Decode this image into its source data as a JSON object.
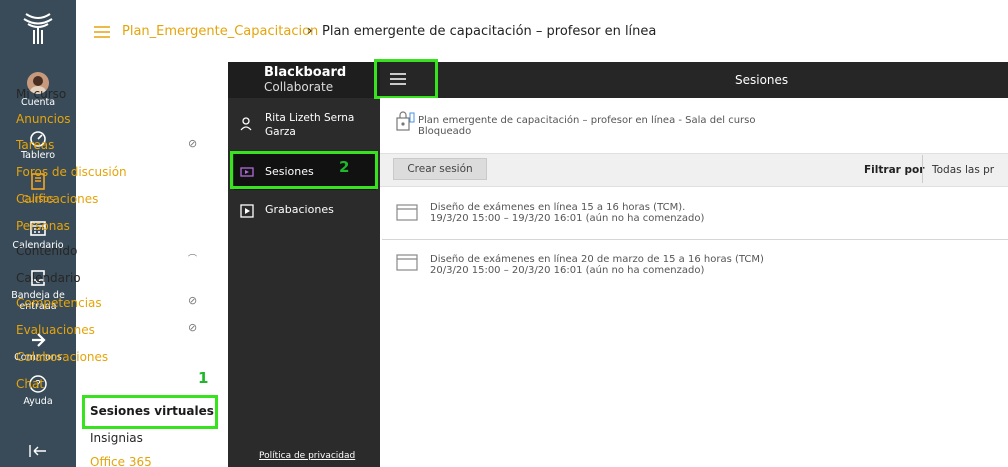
{
  "global_nav": {
    "items": [
      {
        "label": "Cuenta",
        "icon": "avatar"
      },
      {
        "label": "Tablero",
        "icon": "dashboard-icon"
      },
      {
        "label": "Cursos",
        "icon": "courses-icon"
      },
      {
        "label": "Calendario",
        "icon": "calendar-icon"
      },
      {
        "label": "Bandeja de entrada",
        "icon": "inbox-icon"
      },
      {
        "label": "Commons",
        "icon": "commons-icon"
      },
      {
        "label": "Ayuda",
        "icon": "help-icon"
      }
    ],
    "active_item": "Cursos",
    "colors": {
      "background": "#394b58",
      "active": "#f5a623"
    }
  },
  "breadcrumb": {
    "course": "Plan_Emergente_Capacitacion",
    "separator": "›",
    "current": "Plan emergente de capacitación – profesor en línea"
  },
  "course_menu": {
    "items": [
      {
        "label": "Mi curso",
        "style": "dark"
      },
      {
        "label": "Anuncios",
        "style": "link"
      },
      {
        "label": "Tareas",
        "style": "link",
        "hidden": true
      },
      {
        "label": "Foros de discusión",
        "style": "link"
      },
      {
        "label": "Calificaciones",
        "style": "link"
      },
      {
        "label": "Personas",
        "style": "link"
      },
      {
        "label": "Contenido",
        "style": "dark"
      },
      {
        "label": "Calendario",
        "style": "dark"
      },
      {
        "label": "Competencias",
        "style": "link",
        "hidden": true
      },
      {
        "label": "Evaluaciones",
        "style": "link",
        "hidden": true
      },
      {
        "label": "Colaboraciones",
        "style": "link"
      },
      {
        "label": "Chat",
        "style": "link"
      },
      {
        "label": "Sesiones virtuales",
        "style": "bold",
        "highlighted": true
      },
      {
        "label": "Insignias",
        "style": "dark"
      },
      {
        "label": "Office 365",
        "style": "link"
      }
    ],
    "step_number": "1",
    "link_color": "#e5a40b"
  },
  "collaborate": {
    "logo_line1": "Blackboard",
    "logo_line2": "Collaborate",
    "user_name": "Rita Lizeth Serna Garza",
    "nav": [
      {
        "label": "Sesiones",
        "selected": true,
        "icon": "sessions-icon"
      },
      {
        "label": "Grabaciones",
        "selected": false,
        "icon": "recordings-icon"
      }
    ],
    "step_number": "2",
    "privacy_link": "Política de privacidad",
    "header_title": "Sesiones",
    "course_room": {
      "title": "Plan emergente de capacitación – profesor en línea - Sala del curso",
      "status": "Bloqueado"
    },
    "create_button": "Crear sesión",
    "filter_label": "Filtrar por",
    "filter_value": "Todas las pr",
    "sessions": [
      {
        "title": "Diseño de exámenes en línea 15 a 16 horas (TCM).",
        "time": "19/3/20 15:00 – 19/3/20 16:01 (aún no ha comenzado)"
      },
      {
        "title": "Diseño de exámenes en línea 20 de marzo de 15 a 16 horas (TCM)",
        "time": "20/3/20 15:00 – 20/3/20 16:01 (aún no ha comenzado)"
      }
    ],
    "highlight_color": "#39e21f"
  }
}
